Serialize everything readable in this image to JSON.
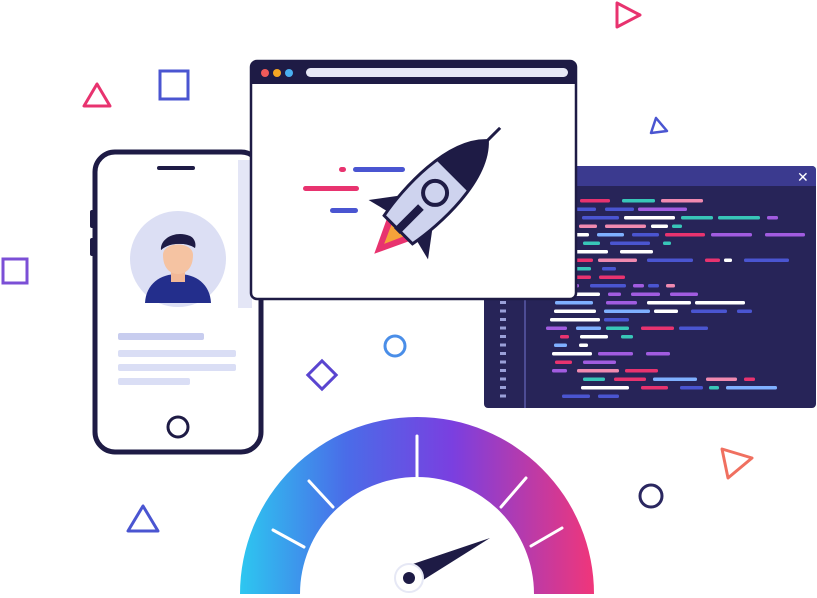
{
  "scene": {
    "close_glyph": "✕",
    "colors": {
      "outline": "#1e1b45",
      "code_bg": "#272458",
      "code_bar": "#3b3a8f",
      "pink": "#e8336f",
      "blue": "#4a55d1",
      "teal": "#38c6b8",
      "purple": "#7b4fd6",
      "gauge_start": "#2dc7f0",
      "gauge_mid": "#7a3fe0",
      "gauge_end": "#f0367a"
    },
    "icons": [
      "rocket-icon",
      "user-avatar-icon",
      "speedometer-icon",
      "close-icon",
      "home-button-icon"
    ]
  }
}
